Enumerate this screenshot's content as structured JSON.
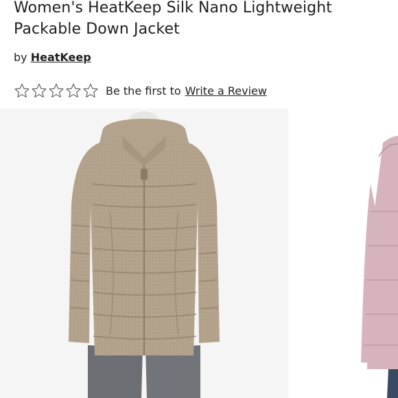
{
  "product": {
    "title_line1": "Women's HeatKeep Silk Nano Lightweight",
    "title_line2": "Packable Down Jacket",
    "by_label": "by",
    "brand": "HeatKeep"
  },
  "rating": {
    "stars_filled": 0,
    "stars_total": 5,
    "prompt_text": "Be the first to",
    "link_text": "Write a Review"
  },
  "gallery": {
    "images": [
      {
        "name": "taupe-jacket-front",
        "jacket_color": "#b3a28c",
        "selected": true
      },
      {
        "name": "pink-jacket-front",
        "jacket_color": "#d6b4bd",
        "selected": false
      }
    ]
  }
}
